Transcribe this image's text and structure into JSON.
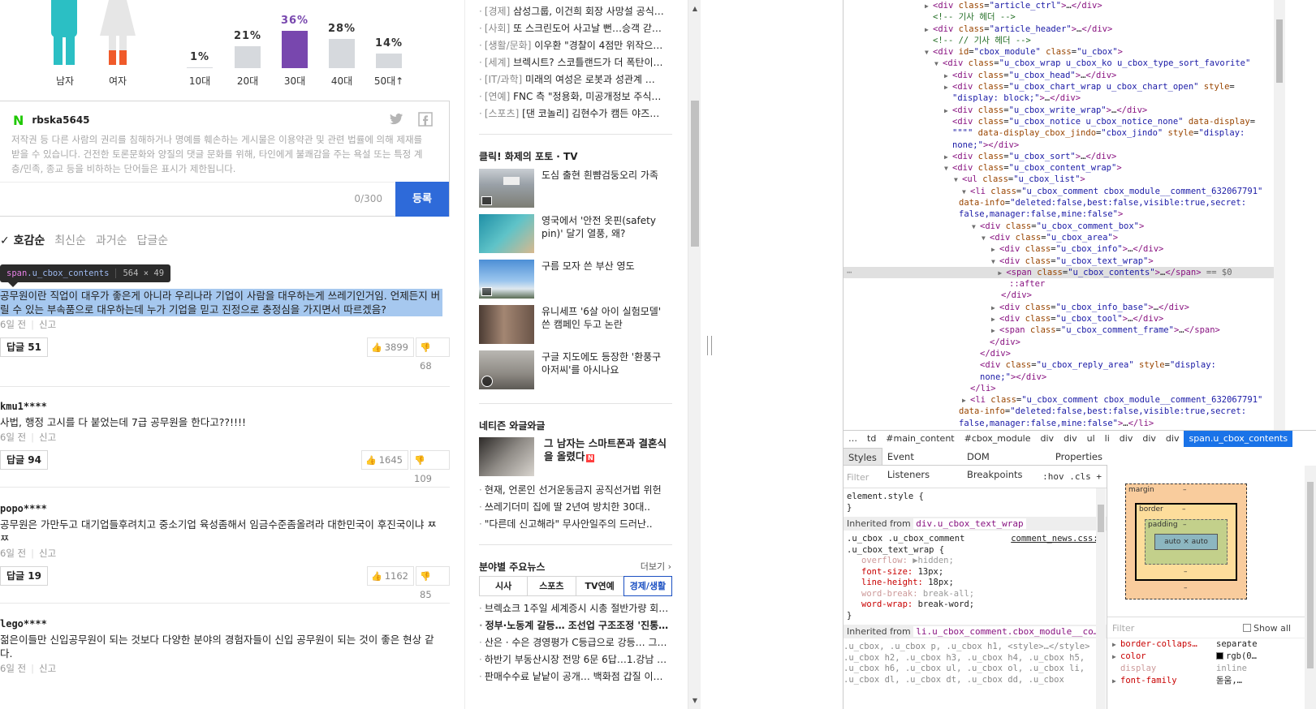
{
  "demographics": {
    "gender": [
      {
        "label": "남자"
      },
      {
        "label": "여자"
      }
    ],
    "age": [
      {
        "label": "10대",
        "pct": "1%",
        "value": 1
      },
      {
        "label": "20대",
        "pct": "21%",
        "value": 21
      },
      {
        "label": "30대",
        "pct": "36%",
        "value": 36,
        "highlight": true
      },
      {
        "label": "40대",
        "pct": "28%",
        "value": 28
      },
      {
        "label": "50대↑",
        "pct": "14%",
        "value": 14
      }
    ],
    "colors": {
      "male": "#2bbfc4",
      "female": "#e6e6e6",
      "highlight": "#7847ae",
      "bar": "#d6d9dd"
    }
  },
  "write_box": {
    "logo": "N",
    "user_id": "rbska5645",
    "notice": "저작권 등 다른 사람의 권리를 침해하거나 명예를 훼손하는 게시물은 이용약관 및 관련 법률에 의해 제재를 받을 수 있습니다. 건전한 토론문화와 양질의 댓글 문화를 위해, 타인에게 불쾌감을 주는 욕설 또는 특정 계층/민족, 종교 등을 비하하는 단어들은 표시가 제한됩니다.",
    "counter": "0/300",
    "submit_label": "등록"
  },
  "sort": {
    "selected": "호감순",
    "options": [
      "최신순",
      "과거순",
      "답글순"
    ]
  },
  "tooltip": {
    "tag": "span",
    "cls": ".u_cbox_contents",
    "dims": "564 × 49"
  },
  "comments": [
    {
      "author": "",
      "text": "공무원이란 직업이 대우가 좋은게 아니라 우리나라 기업이 사람을 대우하는게 쓰레기인거임. 언제든지 버릴 수 있는 부속품으로 대우하는데 누가 기업을 믿고 진정으로 충정심을 가지면서 따르겠음?",
      "time": "6일 전",
      "report": "신고",
      "reply": "답글 51",
      "up": "3899",
      "down": "68"
    },
    {
      "author": "kmu1****",
      "text": "사법, 행정 고시를 다 붙었는데 7급 공무원을 한다고??!!!!",
      "time": "6일 전",
      "report": "신고",
      "reply": "답글 94",
      "up": "1645",
      "down": "109"
    },
    {
      "author": "popo****",
      "text": "공무원은 가만두고 대기업들후려치고 중소기업 육성좀해서 임금수준좀올려라 대한민국이 후진국이냐 ㅉㅉ",
      "time": "6일 전",
      "report": "신고",
      "reply": "답글 19",
      "up": "1162",
      "down": "85"
    },
    {
      "author": "lego****",
      "text": "젊은이들만 신입공무원이 되는 것보다 다양한 분야의 경험자들이 신입 공무원이 되는 것이 좋은 현상 같다.",
      "time": "6일 전",
      "report": "신고"
    }
  ],
  "news": [
    {
      "cat": "[경제]",
      "title": "삼성그룹, 이건희 회장 사망설 공식…"
    },
    {
      "cat": "[사회]",
      "title": "또 스크린도어 사고날 뻔…승객 갇…"
    },
    {
      "cat": "[생활/문화]",
      "title": "이우환 \"경찰이 4점만 위작으…"
    },
    {
      "cat": "[세계]",
      "title": "브렉시트? 스코틀랜드가 더 폭탄이…"
    },
    {
      "cat": "[IT/과학]",
      "title": "미래의 여성은 로봇과 성관계 …"
    },
    {
      "cat": "[연예]",
      "title": "FNC 측 \"정용화, 미공개정보 주식…"
    },
    {
      "cat": "[스포츠]",
      "title": "[댄 코놀리] 김현수가 캠든 야즈…"
    }
  ],
  "photo_section": {
    "title": "클릭! 화제의 포토 · TV",
    "items": [
      {
        "caption": "도심 출현 흰뺨검둥오리 가족",
        "video": true
      },
      {
        "caption": "영국에서 '안전 옷핀(safety pin)' 달기 열풍, 왜?",
        "video": false
      },
      {
        "caption": "구름 모자 쓴 부산 영도",
        "video": true
      },
      {
        "caption": "유니세프 '6살 아이 실험모델' 쓴 캠페인 두고 논란",
        "video": false
      },
      {
        "caption": "구글 지도에도 등장한 '환풍구 아저씨'를 아시나요",
        "video": true
      }
    ]
  },
  "netizen_section": {
    "title": "네티즌 와글와글",
    "feature": "그 남자는 스마트폰과 결혼식을 올렸다",
    "feature_badge": "N",
    "items": [
      "현재, 언론인 선거운동금지 공직선거법 위헌",
      "쓰레기더미 집에 딸 2년여 방치한 30대..",
      "\"다른데 신고해라\" 무사안일주의 드러난.."
    ]
  },
  "main_news": {
    "title": "분야별 주요뉴스",
    "more": "더보기",
    "tabs": [
      "시사",
      "스포츠",
      "TV연예",
      "경제/생활"
    ],
    "active_tab": 3,
    "items": [
      "브렉쇼크 1주일 세계증시 시총 절반가량 회…",
      "정부·노동계 갈등… 조선업 구조조정 '진통…",
      "산은 · 수은 경영평가 C등급으로 강등… 그…",
      "하반기 부동산시장 전망 6문 6답…1.강남 …",
      "판매수수료 낱낱이 공개… 백화점 갑질 이…"
    ]
  },
  "devtools": {
    "breadcrumbs": [
      "…",
      "td",
      "#main_content",
      "#cbox_module",
      "div",
      "div",
      "ul",
      "li",
      "div",
      "div",
      "div",
      "span.u_cbox_contents"
    ],
    "tabs": [
      "Styles",
      "Event Listeners",
      "DOM Breakpoints",
      "Properties"
    ],
    "filter_placeholder": "Filter",
    "filter_tools": ":hov  .cls  +",
    "element_style": "element.style {",
    "inherited_1": "div.u_cbox_text_wrap",
    "inherited_2": "li.u_cbox_comment.cbox_module__co…",
    "inherited_label": "Inherited from",
    "rule1_selector": ".u_cbox .u_cbox_comment .u_cbox_text_wrap {",
    "rule1_src": "comment_news.css:3",
    "rule1_props": [
      {
        "name": "overflow",
        "value": "▶hidden;",
        "dim": true
      },
      {
        "name": "font-size",
        "value": "13px;"
      },
      {
        "name": "line-height",
        "value": "18px;"
      },
      {
        "name": "word-break",
        "value": "break-all;",
        "dim": true
      },
      {
        "name": "word-wrap",
        "value": "break-word;"
      }
    ],
    "rule2_lines": [
      ".u_cbox, .u_cbox p, .u_cbox h1, <style>…</style>",
      ".u_cbox h2, .u_cbox h3, .u_cbox h4, .u_cbox h5,",
      ".u_cbox h6, .u_cbox ul, .u_cbox ol, .u_cbox li,",
      ".u_cbox dl, .u_cbox dt, .u_cbox dd, .u_cbox"
    ],
    "box_model": {
      "margin": "margin",
      "border": "border",
      "padding": "padding",
      "content": "auto × auto",
      "dash": "–"
    },
    "computed_filter": "Filter",
    "show_all": "Show all",
    "computed": [
      {
        "name": "border-collaps…",
        "value": "separate"
      },
      {
        "name": "color",
        "value": "rgb(0…"
      },
      {
        "name": "display",
        "value": "inline",
        "dim": true
      },
      {
        "name": "font-family",
        "value": "돋움,…"
      }
    ]
  }
}
